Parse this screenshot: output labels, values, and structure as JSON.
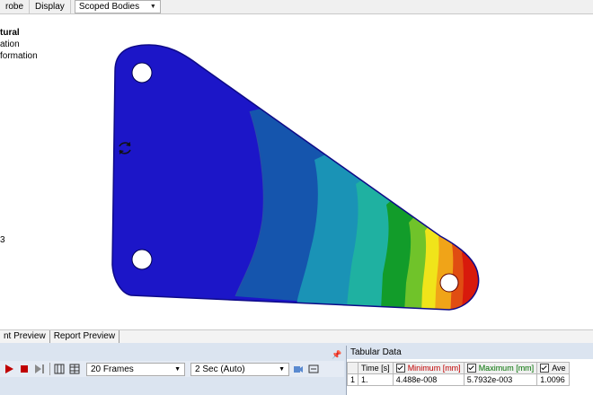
{
  "toolbar": {
    "probe_label": "robe",
    "display_label": "Display",
    "scope_select": "Scoped Bodies"
  },
  "legend": {
    "line1": "tural",
    "line2": "ation",
    "line3": "formation",
    "value_fragment": "3"
  },
  "preview_tabs": {
    "tab1": "nt Preview",
    "tab2": "Report Preview"
  },
  "animation": {
    "frames": "20 Frames",
    "duration": "2 Sec (Auto)"
  },
  "tabular_data": {
    "title": "Tabular Data",
    "columns": [
      "Time [s]",
      "Minimum [mm]",
      "Maximum [mm]",
      "Ave"
    ],
    "rows": [
      {
        "index": "1",
        "time": "1.",
        "min": "4.488e-008",
        "max": "5.7932e-003",
        "avg": "1.0096"
      }
    ]
  },
  "colors": {
    "contour_blue": "#1a1acc",
    "contour_red": "#e00000",
    "panel_bg": "#dbe4f0"
  }
}
